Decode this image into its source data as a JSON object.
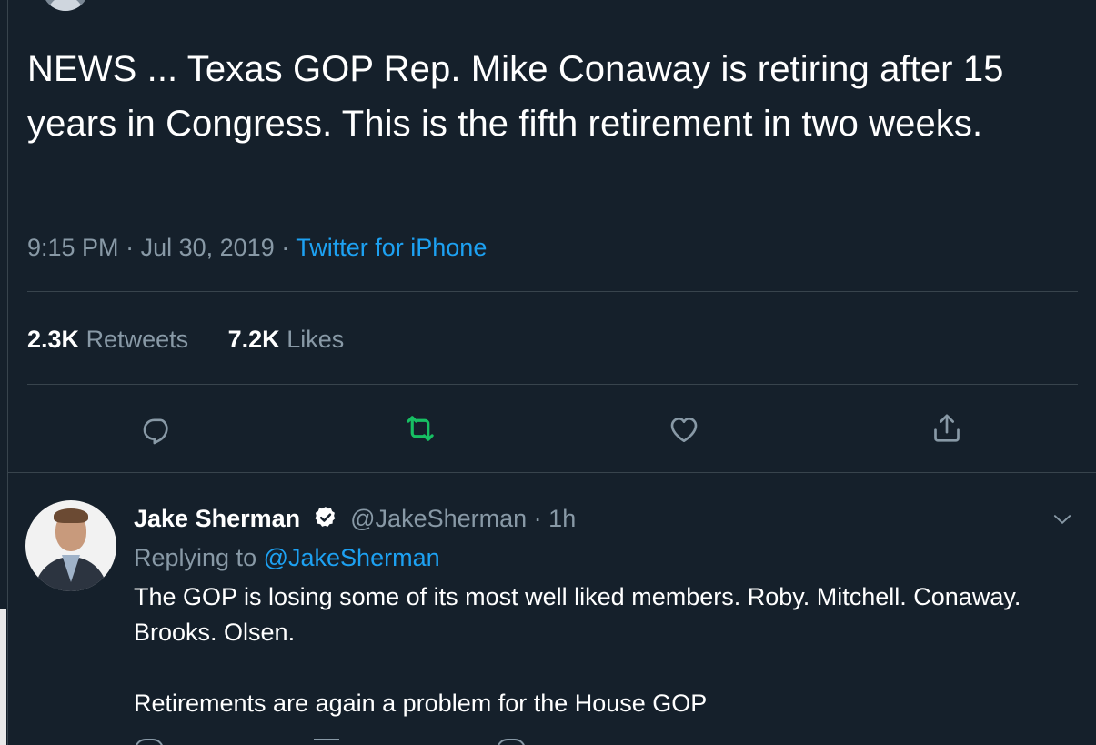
{
  "tweet": {
    "text": "NEWS ... Texas GOP Rep. Mike Conaway is retiring after 15 years in Congress. This is the fifth retirement in two weeks.",
    "time": "9:15 PM",
    "date": "Jul 30, 2019",
    "separator": "·",
    "source": "Twitter for iPhone",
    "stats": {
      "retweets_count": "2.3K",
      "retweets_label": "Retweets",
      "likes_count": "7.2K",
      "likes_label": "Likes"
    },
    "actions": {
      "reply_icon": "reply-icon",
      "retweet_icon": "retweet-icon",
      "like_icon": "heart-icon",
      "share_icon": "share-icon",
      "retweet_active_color": "#17bf63"
    }
  },
  "reply": {
    "name": "Jake Sherman",
    "handle": "@JakeSherman",
    "separator": "·",
    "time": "1h",
    "replying_prefix": "Replying to",
    "replying_to": "@JakeSherman",
    "paragraphs": [
      "The GOP is losing some of its most well liked members. Roby. Mitchell. Conaway. Brooks. Olsen.",
      "Retirements are again a problem for the House GOP"
    ]
  },
  "colors": {
    "background": "#15202b",
    "text": "#ffffff",
    "muted": "#8899a6",
    "accent": "#1da1f2",
    "divider": "#38444d"
  }
}
